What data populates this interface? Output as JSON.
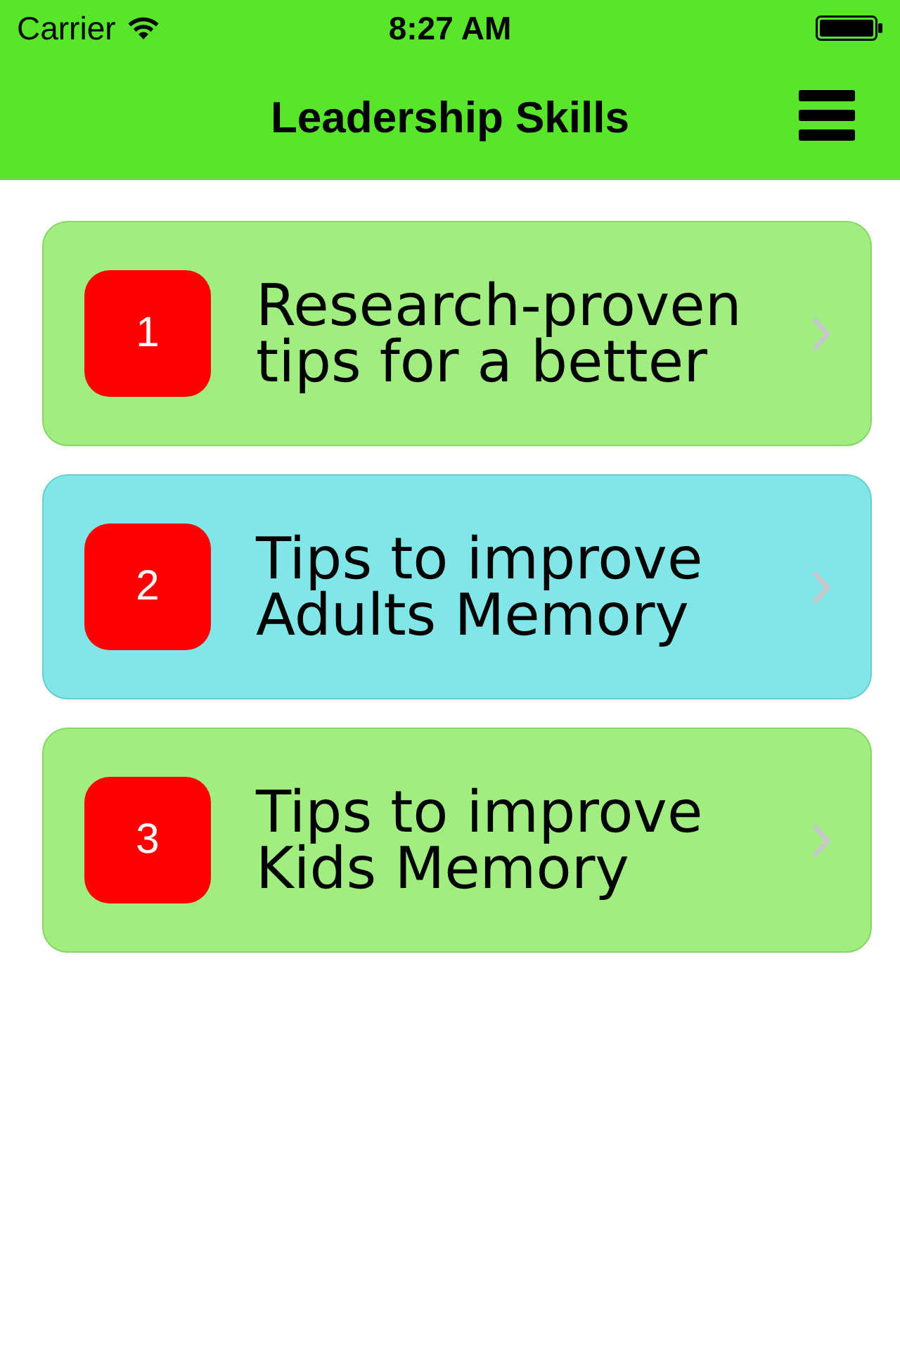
{
  "status_bar": {
    "carrier": "Carrier",
    "time": "8:27 AM"
  },
  "nav_bar": {
    "title": "Leadership Skills"
  },
  "items": [
    {
      "number": "1",
      "title": "Research-proven tips for a better",
      "color": "#a0ee80"
    },
    {
      "number": "2",
      "title": "Tips to improve Adults Memory",
      "color": "#80e6e8"
    },
    {
      "number": "3",
      "title": "Tips to improve Kids Memory",
      "color": "#a0ee80"
    }
  ]
}
